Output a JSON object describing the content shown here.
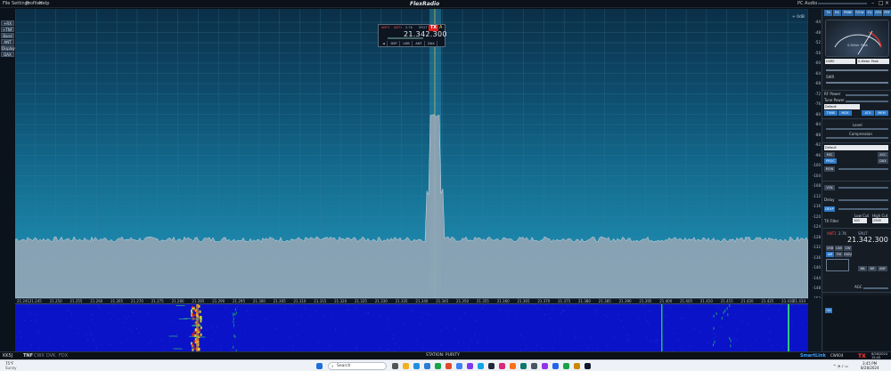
{
  "menu": {
    "items": [
      "File",
      "Settings",
      "Profiles",
      "Help"
    ]
  },
  "app": {
    "title": "FlexRadio"
  },
  "pc_audio": {
    "label": "PC Audio"
  },
  "left_buttons": [
    "+RX",
    "+TNF",
    "Band",
    "ANT",
    "Display",
    "DAX"
  ],
  "slice": {
    "ant_rx": "ANT1",
    "ant_tx": "ANT1",
    "filter": "2.7K",
    "split": "SPLIT",
    "tx": "TX",
    "letter": "A",
    "frequency": "21.342.300",
    "buttons": [
      "DSP",
      "USB",
      "ANT",
      "DAX"
    ]
  },
  "pan": {
    "zoom_label": "+ 0dB",
    "peak_freq": "21.341"
  },
  "db_scale": [
    "-44",
    "-48",
    "-52",
    "-56",
    "-60",
    "-64",
    "-68",
    "-72",
    "-76",
    "-80",
    "-84",
    "-88",
    "-92",
    "-96",
    "-100",
    "-104",
    "-108",
    "-112",
    "-116",
    "-120",
    "-124",
    "-128",
    "-132",
    "-136",
    "-140",
    "-144",
    "-148",
    "-152"
  ],
  "freq_scale": [
    "21.241",
    "21.245",
    "21.250",
    "21.255",
    "21.260",
    "21.265",
    "21.270",
    "21.275",
    "21.280",
    "21.285",
    "21.290",
    "21.295",
    "21.300",
    "21.305",
    "21.310",
    "21.315",
    "21.320",
    "21.325",
    "21.330",
    "21.335",
    "21.340",
    "21.345",
    "21.350",
    "21.355",
    "21.360",
    "21.365",
    "21.370",
    "21.375",
    "21.380",
    "21.385",
    "21.390",
    "21.395",
    "21.400",
    "21.405",
    "21.410",
    "21.415",
    "21.420",
    "21.425",
    "21.430",
    "21.434"
  ],
  "right": {
    "tabs": [
      "TX",
      "RX",
      "PHNE",
      "P/CW",
      "EQ",
      "CPU",
      "PRF"
    ],
    "meter_label": "S-Meter Peak",
    "meter_select": "DSRE",
    "rx_select": "S-Meter Peak",
    "swr_label": "SWR",
    "rf_power": "RF Power",
    "tune_power": "Tune Power",
    "tx_profile": "Default",
    "tune": "TUNE",
    "mox": "MOX",
    "atu": "ATU",
    "mem": "MEM",
    "mic_level": "Level",
    "compression": "Compression",
    "phone_profile": "Default",
    "mic": "MIC",
    "acc": "ACC",
    "proc": "PROC",
    "dax": "DAX",
    "mon": "MON",
    "vox": "VOX",
    "delay": "Delay",
    "dexp": "DEXP",
    "tx_filter": "TX Filter",
    "tx_filter_low": "100",
    "tx_filter_high": "2900",
    "low_cut": "Low Cut",
    "high_cut": "High Cut",
    "control": "Control",
    "rx_freq": "21.342.300",
    "rx_ant": "ANT1",
    "rx_filter": "2.7K",
    "modes": [
      "USB",
      "LSB",
      "CW",
      "AM",
      "FM",
      "DIGU",
      "DIGL"
    ],
    "agc": "AGC",
    "nb": "NB",
    "nr": "NR",
    "anf": "ANF",
    "split": "SPLIT"
  },
  "status": {
    "left": "TNF",
    "cwx": "CWX",
    "dvk": "DVK",
    "fdx": "FDX",
    "station_label": "STATION: PURITY",
    "callsign": "KK5J",
    "smartlink": "SmartLink",
    "gps": "CW004",
    "tx": "TX",
    "date": "8/28/2024",
    "time": "15:45"
  },
  "taskbar": {
    "search": "Search",
    "weather": "75°F",
    "weather_desc": "Sunny",
    "time": "3:45 PM",
    "date": "8/28/2024"
  },
  "colors": {
    "accent": "#2a78c8",
    "tx_red": "#e02020",
    "waterfall_bg": "#0a13c8",
    "pan_top": "#0b2f47",
    "pan_bottom": "#2293b8"
  }
}
